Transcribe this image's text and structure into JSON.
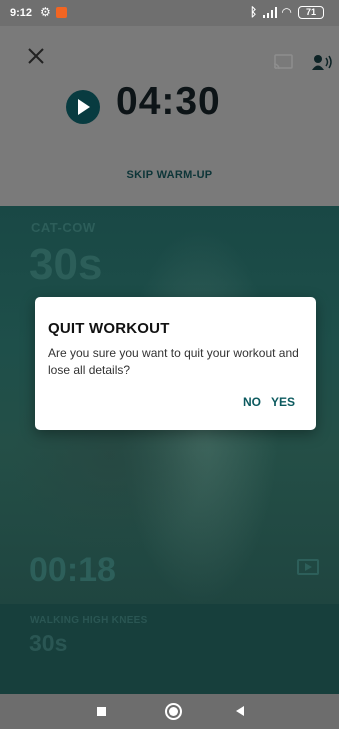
{
  "status_bar": {
    "time": "9:12",
    "battery": "71",
    "notification_color": "#f26522",
    "icons": [
      "settings-icon",
      "bluetooth-icon",
      "signal-icon",
      "wifi-icon",
      "battery-icon"
    ]
  },
  "header": {
    "timer": "04:30",
    "skip_label": "SKIP WARM-UP",
    "icons": [
      "close-icon",
      "cast-icon",
      "voice-guide-icon",
      "play-icon"
    ]
  },
  "current_exercise": {
    "name": "CAT-COW",
    "duration": "30s",
    "elapsed": "00:18"
  },
  "next_exercise": {
    "name": "WALKING HIGH KNEES",
    "duration": "30s"
  },
  "dialog": {
    "title": "QUIT WORKOUT",
    "message": "Are you sure you want to quit your workout and lose all details?",
    "no_label": "NO",
    "yes_label": "YES"
  },
  "colors": {
    "accent": "#0c5a5f",
    "video_bg": "#1e4f4a",
    "dim_header": "#7a7a7a"
  },
  "nav": {
    "icons": [
      "recent-apps-icon",
      "home-icon",
      "back-icon"
    ]
  }
}
